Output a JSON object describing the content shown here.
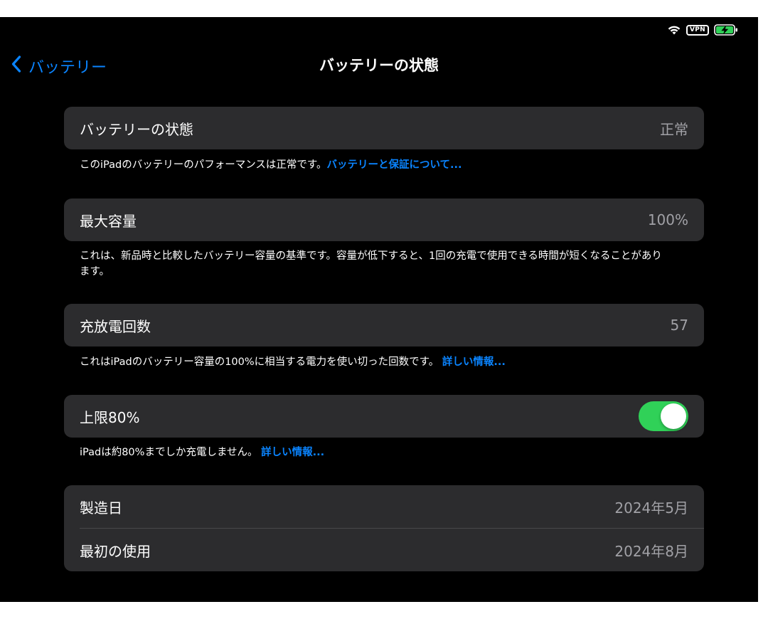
{
  "status_bar": {
    "wifi_icon": "wifi-icon",
    "vpn_label": "VPN",
    "battery_icon": "battery-charging-icon",
    "battery_color": "#30d158"
  },
  "nav": {
    "back_label": "バッテリー",
    "title": "バッテリーの状態"
  },
  "battery_health": {
    "label": "バッテリーの状態",
    "value": "正常",
    "footer_text": "このiPadのバッテリーのパフォーマンスは正常です。",
    "footer_link": "バッテリーと保証について..."
  },
  "max_capacity": {
    "label": "最大容量",
    "value": "100%",
    "footer_text": "これは、新品時と比較したバッテリー容量の基準です。容量が低下すると、1回の充電で使用できる時間が短くなることがあります。"
  },
  "cycle_count": {
    "label": "充放電回数",
    "value": "57",
    "footer_text": "これはiPadのバッテリー容量の100%に相当する電力を使い切った回数です。",
    "footer_link": "詳しい情報..."
  },
  "limit": {
    "label": "上限80%",
    "toggle_on": true,
    "toggle_color": "#30d158",
    "footer_text": "iPadは約80%までしか充電しません。",
    "footer_link": "詳しい情報..."
  },
  "dates": {
    "manufacture_label": "製造日",
    "manufacture_value": "2024年5月",
    "first_use_label": "最初の使用",
    "first_use_value": "2024年8月"
  },
  "colors": {
    "accent": "#0a84ff",
    "cell_background": "#2c2c2e",
    "secondary_text": "#a1a1a6"
  }
}
